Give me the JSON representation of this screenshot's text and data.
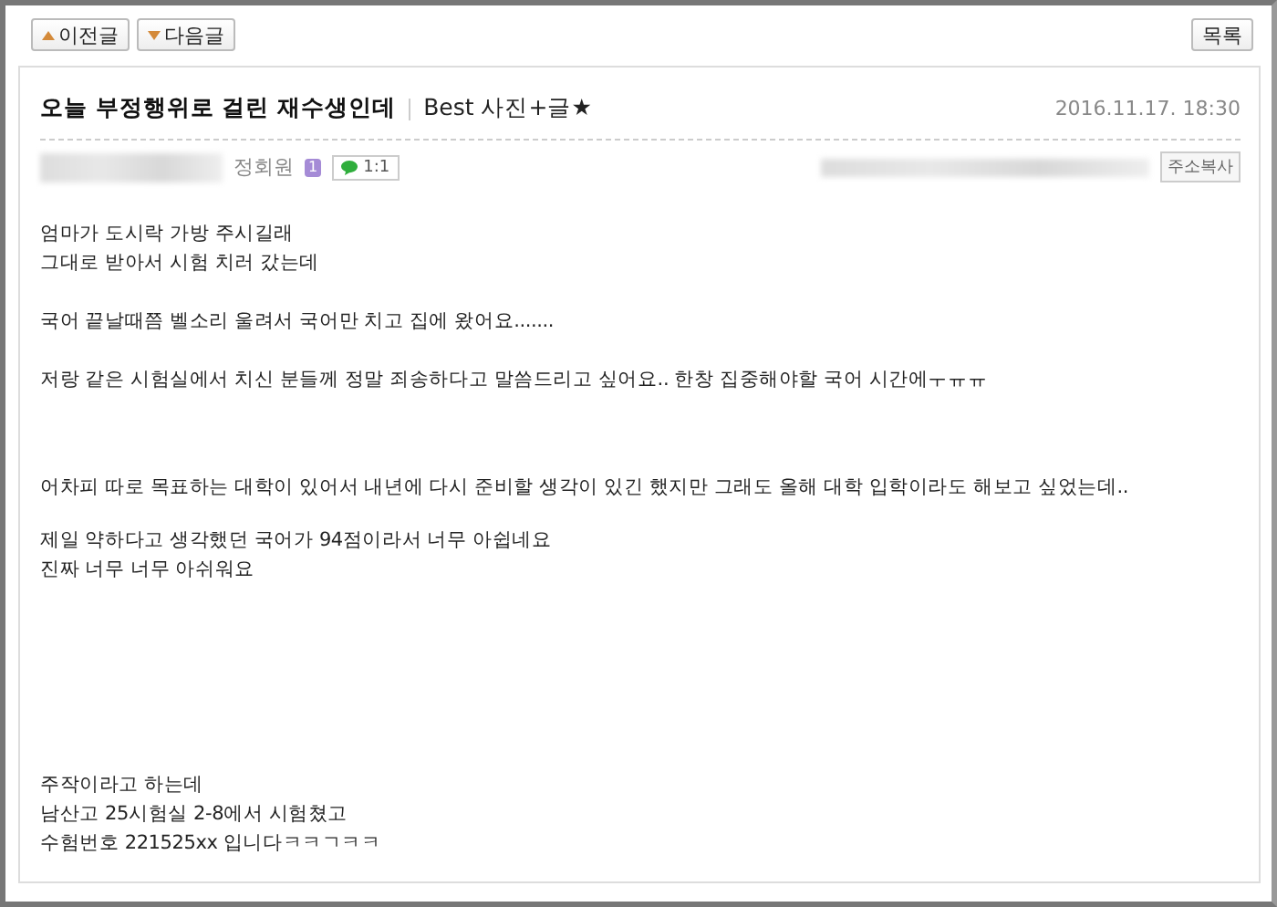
{
  "nav_buttons": [
    {
      "label": "이전글",
      "kind": "up"
    },
    {
      "label": "다음글",
      "kind": "down"
    }
  ],
  "list_button": "목록",
  "post": {
    "title": "오늘 부정행위로 걸린 재수생인데",
    "category": "Best 사진+글★",
    "date": "2016.11.17. 18:30",
    "author": {
      "rank": "정회원",
      "level_badge": "1",
      "chat_label": "1:1"
    },
    "copy_url_button": "주소복사",
    "paragraphs": [
      [
        "엄마가 도시락 가방 주시길래",
        "그대로 받아서 시험 치러 갔는데"
      ],
      [
        "국어 끝날때쯤 벨소리 울려서 국어만 치고 집에 왔어요......."
      ],
      [
        "저랑 같은 시험실에서 치신 분들께 정말 죄송하다고 말씀드리고 싶어요.. 한창 집중해야할 국어 시간에ㅜㅠㅠ"
      ],
      [
        "어차피 따로 목표하는 대학이 있어서 내년에 다시 준비할 생각이 있긴 했지만 그래도 올해 대학 입학이라도 해보고 싶었는데.."
      ],
      [
        "제일 약하다고 생각했던 국어가 94점이라서 너무 아쉽네요",
        "진짜 너무 너무 아쉬워요"
      ],
      [
        "주작이라고 하는데",
        "남산고 25시험실 2-8에서 시험쳤고",
        "수험번호 221525xx 입니다ㅋㅋㄱㅋㅋ"
      ]
    ]
  }
}
